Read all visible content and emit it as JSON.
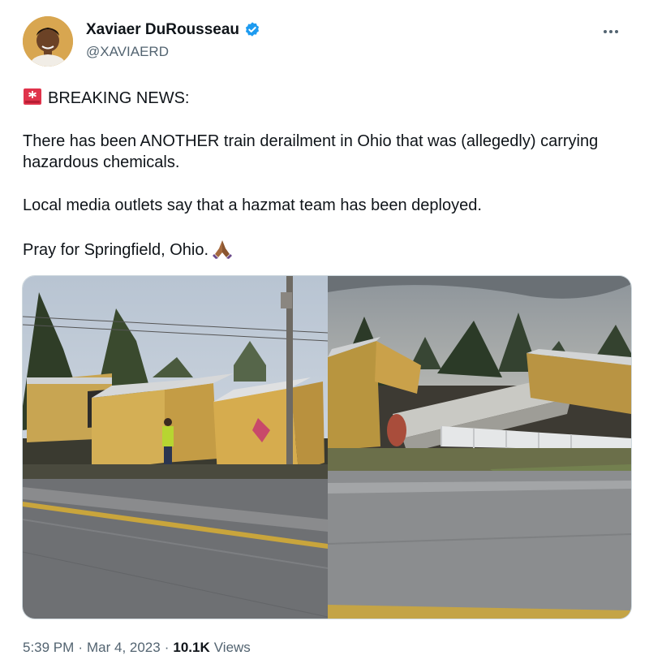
{
  "author": {
    "display_name": "Xaviaer DuRousseau",
    "handle": "@XAVIAERD",
    "verified": true,
    "verified_color": "#1d9bf0"
  },
  "tweet": {
    "paragraphs": [
      "BREAKING NEWS:",
      "There has been ANOTHER train derailment in Ohio that was (allegedly) carrying hazardous chemicals.",
      "Local media outlets say that a hazmat team has been deployed.",
      "Pray for Springfield, Ohio."
    ],
    "emoji": {
      "lead": "rotating-light-icon",
      "trail": "folded-hands-icon"
    }
  },
  "media": {
    "photo_count": 2
  },
  "meta": {
    "time": "5:39 PM",
    "date": "Mar 4, 2023",
    "views_count": "10.1K",
    "views_label": "Views",
    "separator": "·"
  },
  "menu": {
    "more_label": "···"
  },
  "colors": {
    "text": "#0f1419",
    "secondary": "#536471",
    "border": "#cfd9de"
  }
}
